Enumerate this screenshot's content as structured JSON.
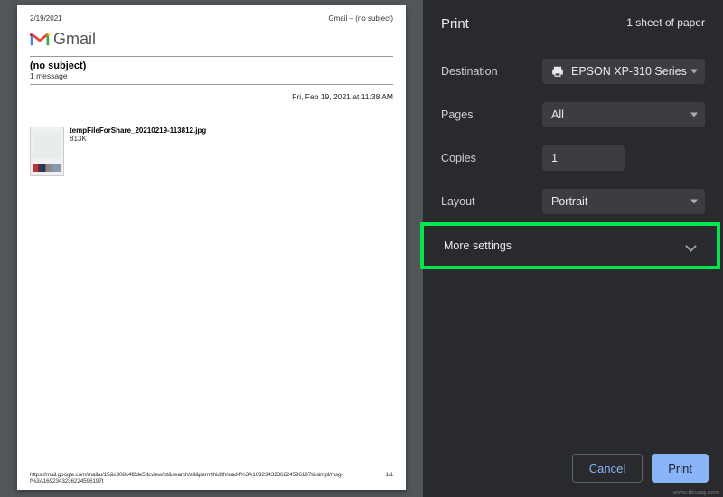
{
  "preview": {
    "header_date": "2/19/2021",
    "header_title": "Gmail – (no subject)",
    "gmail_text": "Gmail",
    "subject": "(no subject)",
    "message_count": "1 message",
    "date_line": "Fri, Feb 19, 2021 at 11:38 AM",
    "attachment": {
      "filename": "tempFileForShare_20210219-113812.jpg",
      "size": "813K"
    },
    "footer_url": "https://mail.google.com/mail/u/15&c908c4f2de5dcview/pt&search/all&permthid/thread-f%3A1692343236224596197t&simpl/msg-f%3A1692343236224596197t",
    "footer_page": "1/1"
  },
  "panel": {
    "title": "Print",
    "sheet_info": "1 sheet of paper",
    "labels": {
      "destination": "Destination",
      "pages": "Pages",
      "copies": "Copies",
      "layout": "Layout"
    },
    "values": {
      "destination": "EPSON XP-310 Series",
      "pages": "All",
      "copies": "1",
      "layout": "Portrait"
    },
    "more_settings": "More settings",
    "buttons": {
      "cancel": "Cancel",
      "print": "Print"
    }
  },
  "watermark": "www.deuaq.com"
}
